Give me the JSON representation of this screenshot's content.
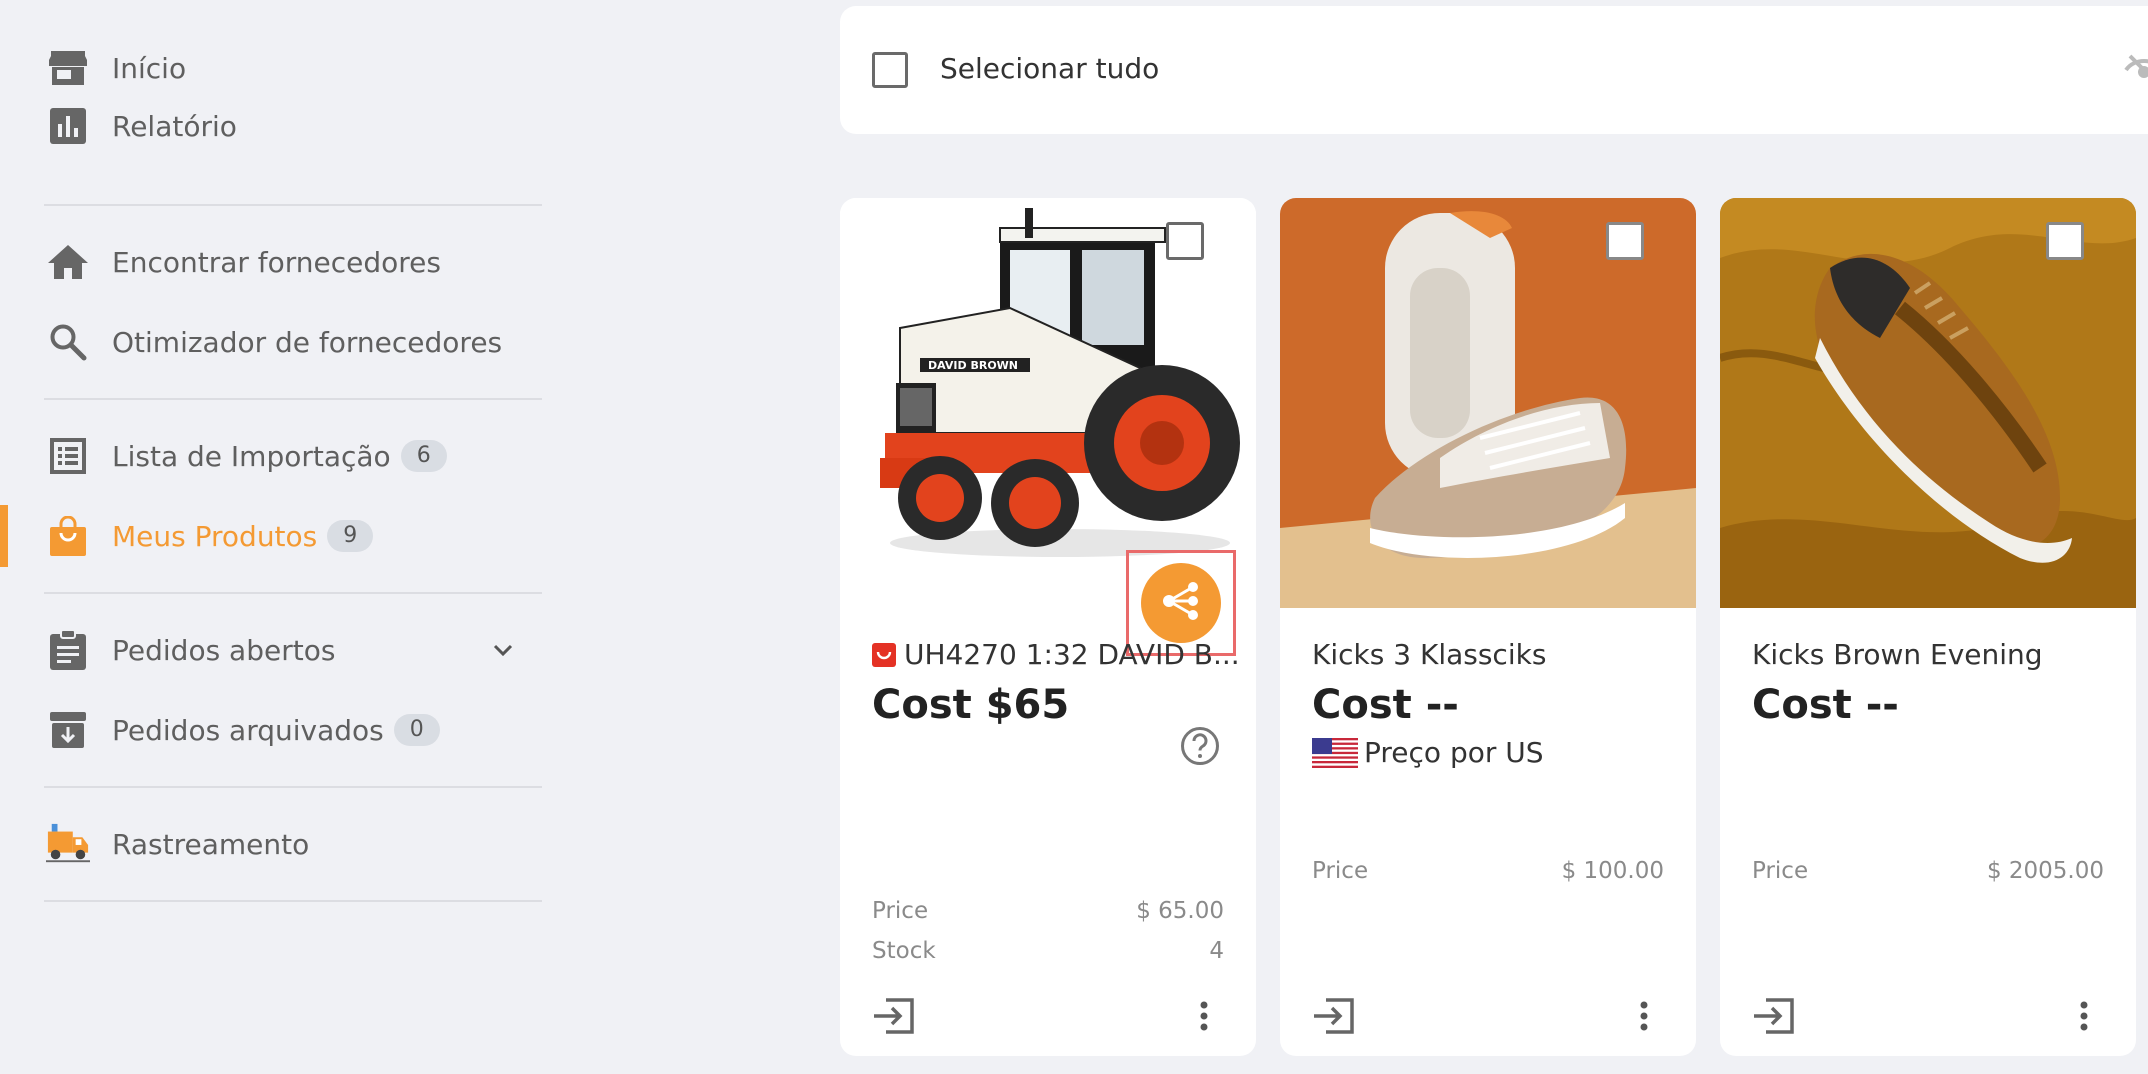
{
  "sidebar": {
    "items": [
      {
        "label": "Início",
        "icon": "store-icon"
      },
      {
        "label": "Relatório",
        "icon": "bar-chart-icon"
      },
      {
        "label": "Encontrar fornecedores",
        "icon": "home-icon"
      },
      {
        "label": "Otimizador de fornecedores",
        "icon": "search-icon"
      },
      {
        "label": "Lista de Importação",
        "icon": "list-icon",
        "badge": "6"
      },
      {
        "label": "Meus Produtos",
        "icon": "shopping-bag-icon",
        "badge": "9",
        "active": true
      },
      {
        "label": "Pedidos abertos",
        "icon": "clipboard-icon"
      },
      {
        "label": "Pedidos arquivados",
        "icon": "archive-icon",
        "badge": "0"
      },
      {
        "label": "Rastreamento",
        "icon": "delivery-truck-icon"
      }
    ]
  },
  "select_bar": {
    "label": "Selecionar tudo",
    "icon": "eye-off-icon"
  },
  "products": [
    {
      "title": "UH4270 1:32 DAVID B...",
      "cost": "Cost $65",
      "source_icon": "aliexpress-icon",
      "price_label": "Price",
      "price": "$ 65.00",
      "stock_label": "Stock",
      "stock": "4",
      "image": "tractor-image"
    },
    {
      "title": "Kicks 3 Klassciks",
      "cost": "Cost --",
      "region": "Preço por US",
      "price_label": "Price",
      "price": "$ 100.00",
      "image": "white-sneakers-image"
    },
    {
      "title": "Kicks Brown Evening",
      "cost": "Cost --",
      "price_label": "Price",
      "price": "$ 2005.00",
      "image": "brown-sneaker-image"
    }
  ],
  "colors": {
    "accent": "#f49a33",
    "background": "#f0f1f5",
    "highlight_border": "#e96a6a"
  }
}
